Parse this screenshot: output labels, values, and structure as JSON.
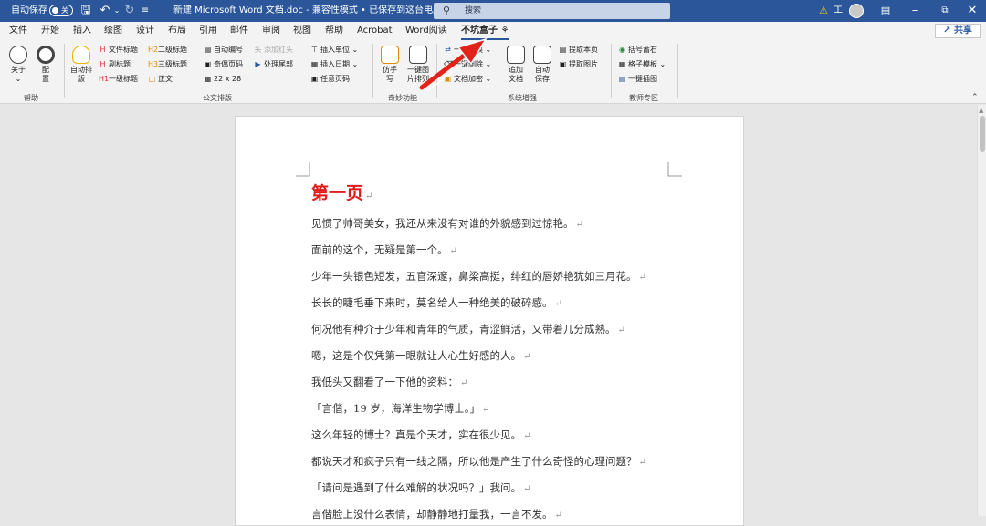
{
  "titlebar": {
    "autosave_label": "自动保存",
    "autosave_state": "关",
    "doc_title": "新建 Microsoft Word 文档.doc - 兼容性模式 • 已保存到这台电脑 ⌄",
    "search_placeholder": "搜索",
    "warning_text": "⚠",
    "user_initial": "工"
  },
  "tabs": [
    "文件",
    "开始",
    "插入",
    "绘图",
    "设计",
    "布局",
    "引用",
    "邮件",
    "审阅",
    "视图",
    "帮助",
    "Acrobat",
    "Word阅读",
    "不坑盒子"
  ],
  "active_tab": "不坑盒子",
  "share_label": "共享",
  "ribbon": {
    "help": {
      "about": "关于",
      "config": "配\n置",
      "group": "帮助"
    },
    "official": {
      "auto_layout": "自动排\n版",
      "file_title": "文件标题",
      "sub_title": "副标题",
      "h1": "一级标题",
      "h2": "二级标题",
      "h3": "三级标题",
      "body": "正文",
      "auto_number": "自动编号",
      "odd_even": "奇偶页码",
      "grid": "22 x 28",
      "add_header": "添加红头",
      "process_tail": "处理尾部",
      "insert_unit": "插入单位",
      "insert_date": "插入日期",
      "any_page": "任意页码",
      "group": "公文排版"
    },
    "magic": {
      "handwrite": "仿手\n写",
      "onekey": "一键图\n片排列",
      "group": "奇妙功能"
    },
    "system": {
      "replace": "一键替换",
      "delete": "一键删除",
      "encrypt": "文档加密",
      "append": "追加\n文档",
      "autosave": "自动\n保存",
      "extract_page": "提取本页",
      "extract_img": "提取图片",
      "group": "系统增强"
    },
    "teacher": {
      "bracket": "括号蓄石",
      "template": "格子模板",
      "insert_img": "一键插图",
      "group": "教师专区"
    }
  },
  "document": {
    "title": "第一页",
    "paragraphs": [
      "见惯了帅哥美女，我还从来没有对谁的外貌感到过惊艳。",
      "面前的这个，无疑是第一个。",
      "少年一头银色短发，五官深邃，鼻梁高挺，绯红的唇娇艳犹如三月花。",
      "长长的睫毛垂下来时，莫名给人一种绝美的破碎感。",
      "何况他有种介于少年和青年的气质，青涩鲜活，又带着几分成熟。",
      "嗯，这是个仅凭第一眼就让人心生好感的人。",
      "我低头又翻看了一下他的资料：",
      "「言偕，19 岁，海洋生物学博士。」",
      "这么年轻的博士？真是个天才，实在很少见。",
      "都说天才和疯子只有一线之隔，所以他是产生了什么奇怪的心理问题？",
      "「请问是遇到了什么难解的状况吗？」我问。",
      "言偕脸上没什么表情，却静静地打量我，一言不发。"
    ],
    "para_mark": "↵"
  },
  "colors": {
    "titlebar": "#2b579a",
    "title_red": "#e0191a",
    "arrow": "#e2231a"
  }
}
